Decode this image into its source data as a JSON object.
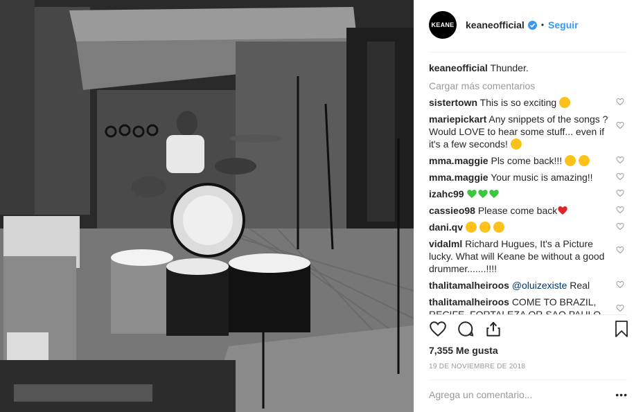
{
  "post": {
    "account": {
      "avatar_text": "KEANE",
      "username": "keaneofficial",
      "follow_label": "Seguir",
      "separator": "•"
    },
    "caption": {
      "username": "keaneofficial",
      "text": "Thunder."
    },
    "load_more_label": "Cargar más comentarios",
    "comments": [
      {
        "username": "sistertown",
        "text": "This is so exciting"
      },
      {
        "username": "mariepickart",
        "text": "Any snippets of the songs ? Would LOVE to hear some stuff... even if it's a few seconds!"
      },
      {
        "username": "mma.maggie",
        "text": "Pls come back!!!"
      },
      {
        "username": "mma.maggie",
        "text": "Your music is amazing!!"
      },
      {
        "username": "izahc99",
        "text": ""
      },
      {
        "username": "cassieo98",
        "text": "Please come back"
      },
      {
        "username": "dani.qv",
        "text": ""
      },
      {
        "username": "vidalml",
        "text": "Richard Hugues, It's a Picture lucky. What will Keane be without a good drummer.......!!!!"
      },
      {
        "username": "thalitamalheiroos",
        "mention": "@oluizexiste",
        "text": "Real"
      },
      {
        "username": "thalitamalheiroos",
        "text": "COME TO BRAZIL, RECIFE, FORTALEZA OR SAO PAULO"
      }
    ],
    "likes_label": "7,355 Me gusta",
    "date": "19 DE NOVIEMBRE DE 2018",
    "add_comment_placeholder": "Agrega un comentario...",
    "more_options": "•••"
  },
  "icons": {
    "verified": "verified-badge-icon",
    "heart": "heart-outline-icon",
    "comment": "speech-bubble-icon",
    "share": "share-icon",
    "save": "bookmark-icon"
  },
  "colors": {
    "accent": "#3897f0",
    "muted": "#999999",
    "text": "#262626"
  }
}
